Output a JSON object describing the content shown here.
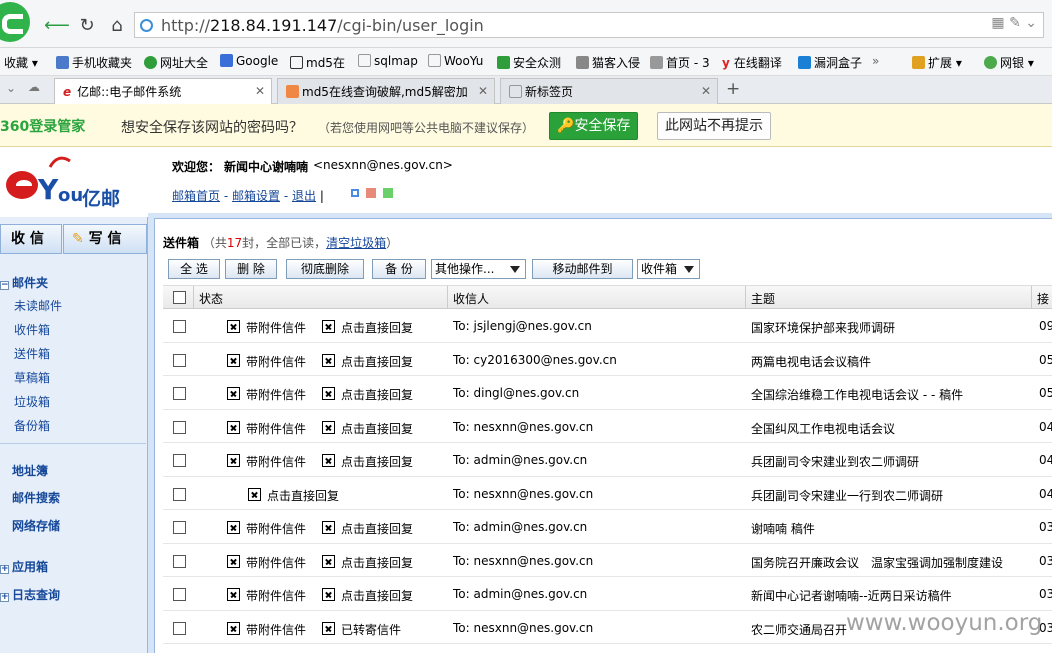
{
  "browser": {
    "url_prefix": "http://",
    "url_host": "218.84.191.147",
    "url_path": "/cgi-bin/user_login",
    "favorites": [
      "收藏",
      "手机收藏夹",
      "网址大全",
      "Google",
      "md5在",
      "sqlmap",
      "WooYu",
      "安全众测",
      "猫客入侵",
      "首页 - 3",
      "在线翻译",
      "漏洞盒子",
      "扩展",
      "网银"
    ],
    "tabs": [
      {
        "title": "亿邮::电子邮件系统"
      },
      {
        "title": "md5在线查询破解,md5解密加"
      },
      {
        "title": "新标签页"
      }
    ]
  },
  "password_bar": {
    "brand": "360登录管家",
    "prompt": "想安全保存该网站的密码吗？",
    "hint": "（若您使用网吧等公共电脑不建议保存）",
    "save": "安全保存",
    "never": "此网站不再提示"
  },
  "header": {
    "welcome": "欢迎您：",
    "user": "新闻中心谢喃喃",
    "email": "<nesxnn@nes.gov.cn>",
    "links": [
      "邮箱首页",
      "邮箱设置",
      "退出"
    ],
    "logo_text": "亿邮"
  },
  "nav": {
    "inbox": "收 信",
    "compose": "写 信",
    "mailbox": "邮件夹",
    "folders": [
      "未读邮件",
      "收件箱",
      "送件箱",
      "草稿箱",
      "垃圾箱",
      "备份箱"
    ],
    "others": [
      "地址簿",
      "邮件搜索",
      "网络存储"
    ],
    "apps": "应用箱",
    "log": "日志查询"
  },
  "list": {
    "folder": "送件箱",
    "summary_pre": "（共",
    "count": "17",
    "summary_post": "封，全部已读，",
    "clear": "清空垃圾箱",
    "close": "）",
    "buttons": [
      "全 选",
      "删 除",
      "彻底删除",
      "备 份"
    ],
    "other_ops": "其他操作...",
    "move": "移动邮件到",
    "target": "收件箱",
    "columns": [
      "状态",
      "收信人",
      "主题",
      "接"
    ],
    "rows": [
      {
        "s1": "带附件信件",
        "s2": "点击直接回复",
        "to": "To: jsjlengj@nes.gov.cn",
        "subject": "国家环境保护部来我师调研",
        "d": "09"
      },
      {
        "s1": "带附件信件",
        "s2": "点击直接回复",
        "to": "To: cy2016300@nes.gov.cn",
        "subject": "两篇电视电话会议稿件",
        "d": "05"
      },
      {
        "s1": "带附件信件",
        "s2": "点击直接回复",
        "to": "To: dingl@nes.gov.cn",
        "subject": "全国综治维稳工作电视电话会议 - - 稿件",
        "d": "05"
      },
      {
        "s1": "带附件信件",
        "s2": "点击直接回复",
        "to": "To: nesxnn@nes.gov.cn",
        "subject": "全国纠风工作电视电话会议",
        "d": "04"
      },
      {
        "s1": "带附件信件",
        "s2": "点击直接回复",
        "to": "To: admin@nes.gov.cn",
        "subject": "兵团副司令宋建业到农二师调研",
        "d": "04"
      },
      {
        "s1": "",
        "s2": "点击直接回复",
        "to": "To: nesxnn@nes.gov.cn",
        "subject": "兵团副司令宋建业一行到农二师调研",
        "d": "04"
      },
      {
        "s1": "带附件信件",
        "s2": "点击直接回复",
        "to": "To: admin@nes.gov.cn",
        "subject": "谢喃喃 稿件",
        "d": "03"
      },
      {
        "s1": "带附件信件",
        "s2": "点击直接回复",
        "to": "To: nesxnn@nes.gov.cn",
        "subject": "国务院召开廉政会议　温家宝强调加强制度建设",
        "d": "03"
      },
      {
        "s1": "带附件信件",
        "s2": "点击直接回复",
        "to": "To: admin@nes.gov.cn",
        "subject": "新闻中心记者谢喃喃--近两日采访稿件",
        "d": "03"
      },
      {
        "s1": "带附件信件",
        "s2": "已转寄信件",
        "to": "To: nesxnn@nes.gov.cn",
        "subject": "农二师交通局召开",
        "d": "03"
      }
    ]
  },
  "watermark": "www.wooyun.org"
}
